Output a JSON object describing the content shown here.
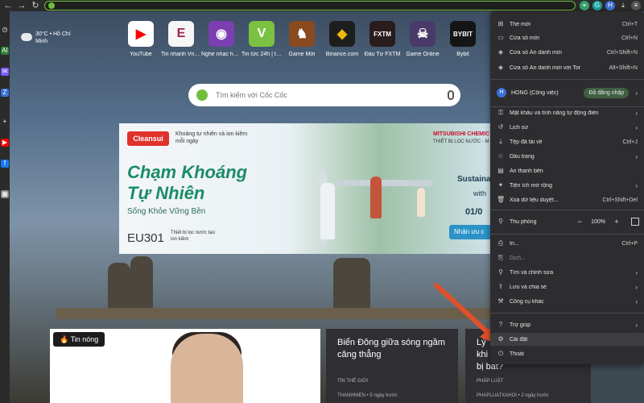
{
  "weather": {
    "temp": "30°C • Hồ Chí",
    "city": "Minh"
  },
  "shortcuts": [
    {
      "label": "YouTube",
      "glyph": "▶",
      "color": "#ff0000"
    },
    {
      "label": "Tin nhanh VnE...",
      "glyph": "E",
      "color": "#a3214d"
    },
    {
      "label": "Nghe nhạc hay...",
      "glyph": "◉",
      "color": "#7b3fb2"
    },
    {
      "label": "Tin tức 24h | ti...",
      "glyph": "V",
      "color": "#7cc242"
    },
    {
      "label": "Game Mới",
      "glyph": "♞",
      "color": "#8a4a1f"
    },
    {
      "label": "Binance.com",
      "glyph": "◆",
      "color": "#1e1e1e"
    },
    {
      "label": "Đầu Tư FXTM",
      "glyph": "FXTM",
      "color": "#2a1c1c"
    },
    {
      "label": "Game Online",
      "glyph": "☠",
      "color": "#4a3a6a"
    },
    {
      "label": "Bybit",
      "glyph": "BYBIT",
      "color": "#151515"
    }
  ],
  "search": {
    "placeholder": "Tìm kiếm với Cốc Cốc"
  },
  "banner": {
    "brand": "Cleansui",
    "tagline": "Khoảng tự nhiên và ion kiềm mỗi ngày",
    "headline1": "Chạm Khoáng",
    "headline2": "Tự Nhiên",
    "subline": "Sống Khỏe Vững Bền",
    "model": "EU301",
    "model_sub": "Thiết bị lọc nước tạo ion kiềm",
    "partner": "MITSUBISHI CHEMIC",
    "partner_sub": "THIẾT BỊ LỌC NƯỚC - M",
    "side1": "Sustainab",
    "side2": "with",
    "date": "01/0",
    "cta": "Nhận ưu c"
  },
  "news": {
    "hot_tag": "Tin nóng",
    "card2": {
      "title": "Biển Đông giữa sóng ngầm căng thẳng",
      "category": "TIN THẾ GIỚI",
      "source": "THANHNIEN • 5 ngày trước"
    },
    "card3": {
      "title": "Lý\nkhi\nbị bắt?",
      "category": "PHÁP LUẬT",
      "source": "PHAPLUATXAHOI • 2 ngày trước"
    }
  },
  "menu": {
    "items_top": [
      {
        "icon": "⊞",
        "label": "Thẻ mới",
        "shortcut": "Ctrl+T"
      },
      {
        "icon": "▭",
        "label": "Cửa sổ mới",
        "shortcut": "Ctrl+N"
      },
      {
        "icon": "◈",
        "label": "Cửa sổ Ẩn danh mới",
        "shortcut": "Ctrl+Shift+N"
      },
      {
        "icon": "◈",
        "label": "Cửa sổ Ẩn danh mới với Tor",
        "shortcut": "Alt+Shift+N"
      }
    ],
    "profile": {
      "avatar": "H",
      "name": "HỒNG (Công việc)",
      "signed": "Đã đăng nhập"
    },
    "items_mid": [
      {
        "icon": "⚿",
        "label": "Mật khẩu và tính năng tự động điền",
        "shortcut": "",
        "chev": "›"
      },
      {
        "icon": "↺",
        "label": "Lịch sử",
        "shortcut": "",
        "chev": "›"
      },
      {
        "icon": "⤓",
        "label": "Tệp đã tải về",
        "shortcut": "Ctrl+J",
        "chev": ""
      },
      {
        "icon": "☆",
        "label": "Dấu trang",
        "shortcut": "",
        "chev": "›"
      },
      {
        "icon": "▤",
        "label": "Ẩn thanh bên",
        "shortcut": "",
        "chev": ""
      },
      {
        "icon": "✦",
        "label": "Tiện ích mở rộng",
        "shortcut": "",
        "chev": "›"
      },
      {
        "icon": "🗑",
        "label": "Xoá dữ liệu duyệt...",
        "shortcut": "Ctrl+Shift+Del",
        "chev": ""
      }
    ],
    "zoom": {
      "icon": "⚲",
      "label": "Thu phóng",
      "minus": "−",
      "value": "100%",
      "plus": "+"
    },
    "items_print": [
      {
        "icon": "⎙",
        "label": "In...",
        "shortcut": "Ctrl+P",
        "chev": ""
      },
      {
        "icon": "⎘",
        "label": "Dịch...",
        "shortcut": "",
        "chev": ""
      },
      {
        "icon": "⚲",
        "label": "Tìm và chỉnh sửa",
        "shortcut": "",
        "chev": "›"
      },
      {
        "icon": "⇪",
        "label": "Lưu và chia sẻ",
        "shortcut": "",
        "chev": "›"
      },
      {
        "icon": "⚒",
        "label": "Công cụ khác",
        "shortcut": "",
        "chev": "›"
      }
    ],
    "items_bottom": [
      {
        "icon": "?",
        "label": "Trợ giúp",
        "shortcut": "",
        "chev": "›"
      },
      {
        "icon": "⚙",
        "label": "Cài đặt",
        "shortcut": "",
        "chev": ""
      },
      {
        "icon": "⏻",
        "label": "Thoát",
        "shortcut": "",
        "chev": ""
      }
    ]
  },
  "colors": {
    "accent": "#6fbf3b",
    "arrow": "#e0502a",
    "menu_bg": "#2d2d30"
  }
}
